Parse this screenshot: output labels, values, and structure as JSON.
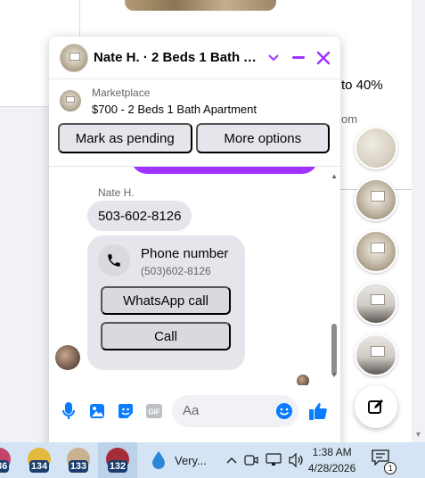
{
  "background": {
    "text_right_1": "to 40%",
    "text_right_2": "om"
  },
  "chat": {
    "title": "Nate H. · 2 Beds 1 Bath Ap...",
    "icons": {
      "dropdown": "chevron-down-icon",
      "minimize": "minus-icon",
      "close": "close-icon"
    },
    "accent": "#a033ff",
    "marketplace": {
      "label": "Marketplace",
      "listing": "$700 - 2 Beds 1 Bath Apartment",
      "buttons": [
        "Mark as pending",
        "More options"
      ]
    },
    "messages": {
      "sender_name": "Nate H.",
      "phone_text": "503-602-8126",
      "card": {
        "icon": "phone-icon",
        "title": "Phone number",
        "number": "(503)602-8126",
        "whatsapp_label": "WhatsApp call",
        "call_label": "Call"
      }
    },
    "composer": {
      "placeholder": "Aa",
      "icons": [
        "microphone-icon",
        "image-icon",
        "sticker-icon",
        "gif-icon",
        "emoji-icon",
        "like-icon"
      ],
      "gif_label": "GIF"
    }
  },
  "taskbar": {
    "apps": [
      {
        "badge": "36"
      },
      {
        "badge": "134"
      },
      {
        "badge": "133"
      },
      {
        "badge": "132"
      }
    ],
    "weather_text": "Very...",
    "time": "1:38 AM",
    "date": "4/28/2026",
    "notification_count": "1"
  }
}
